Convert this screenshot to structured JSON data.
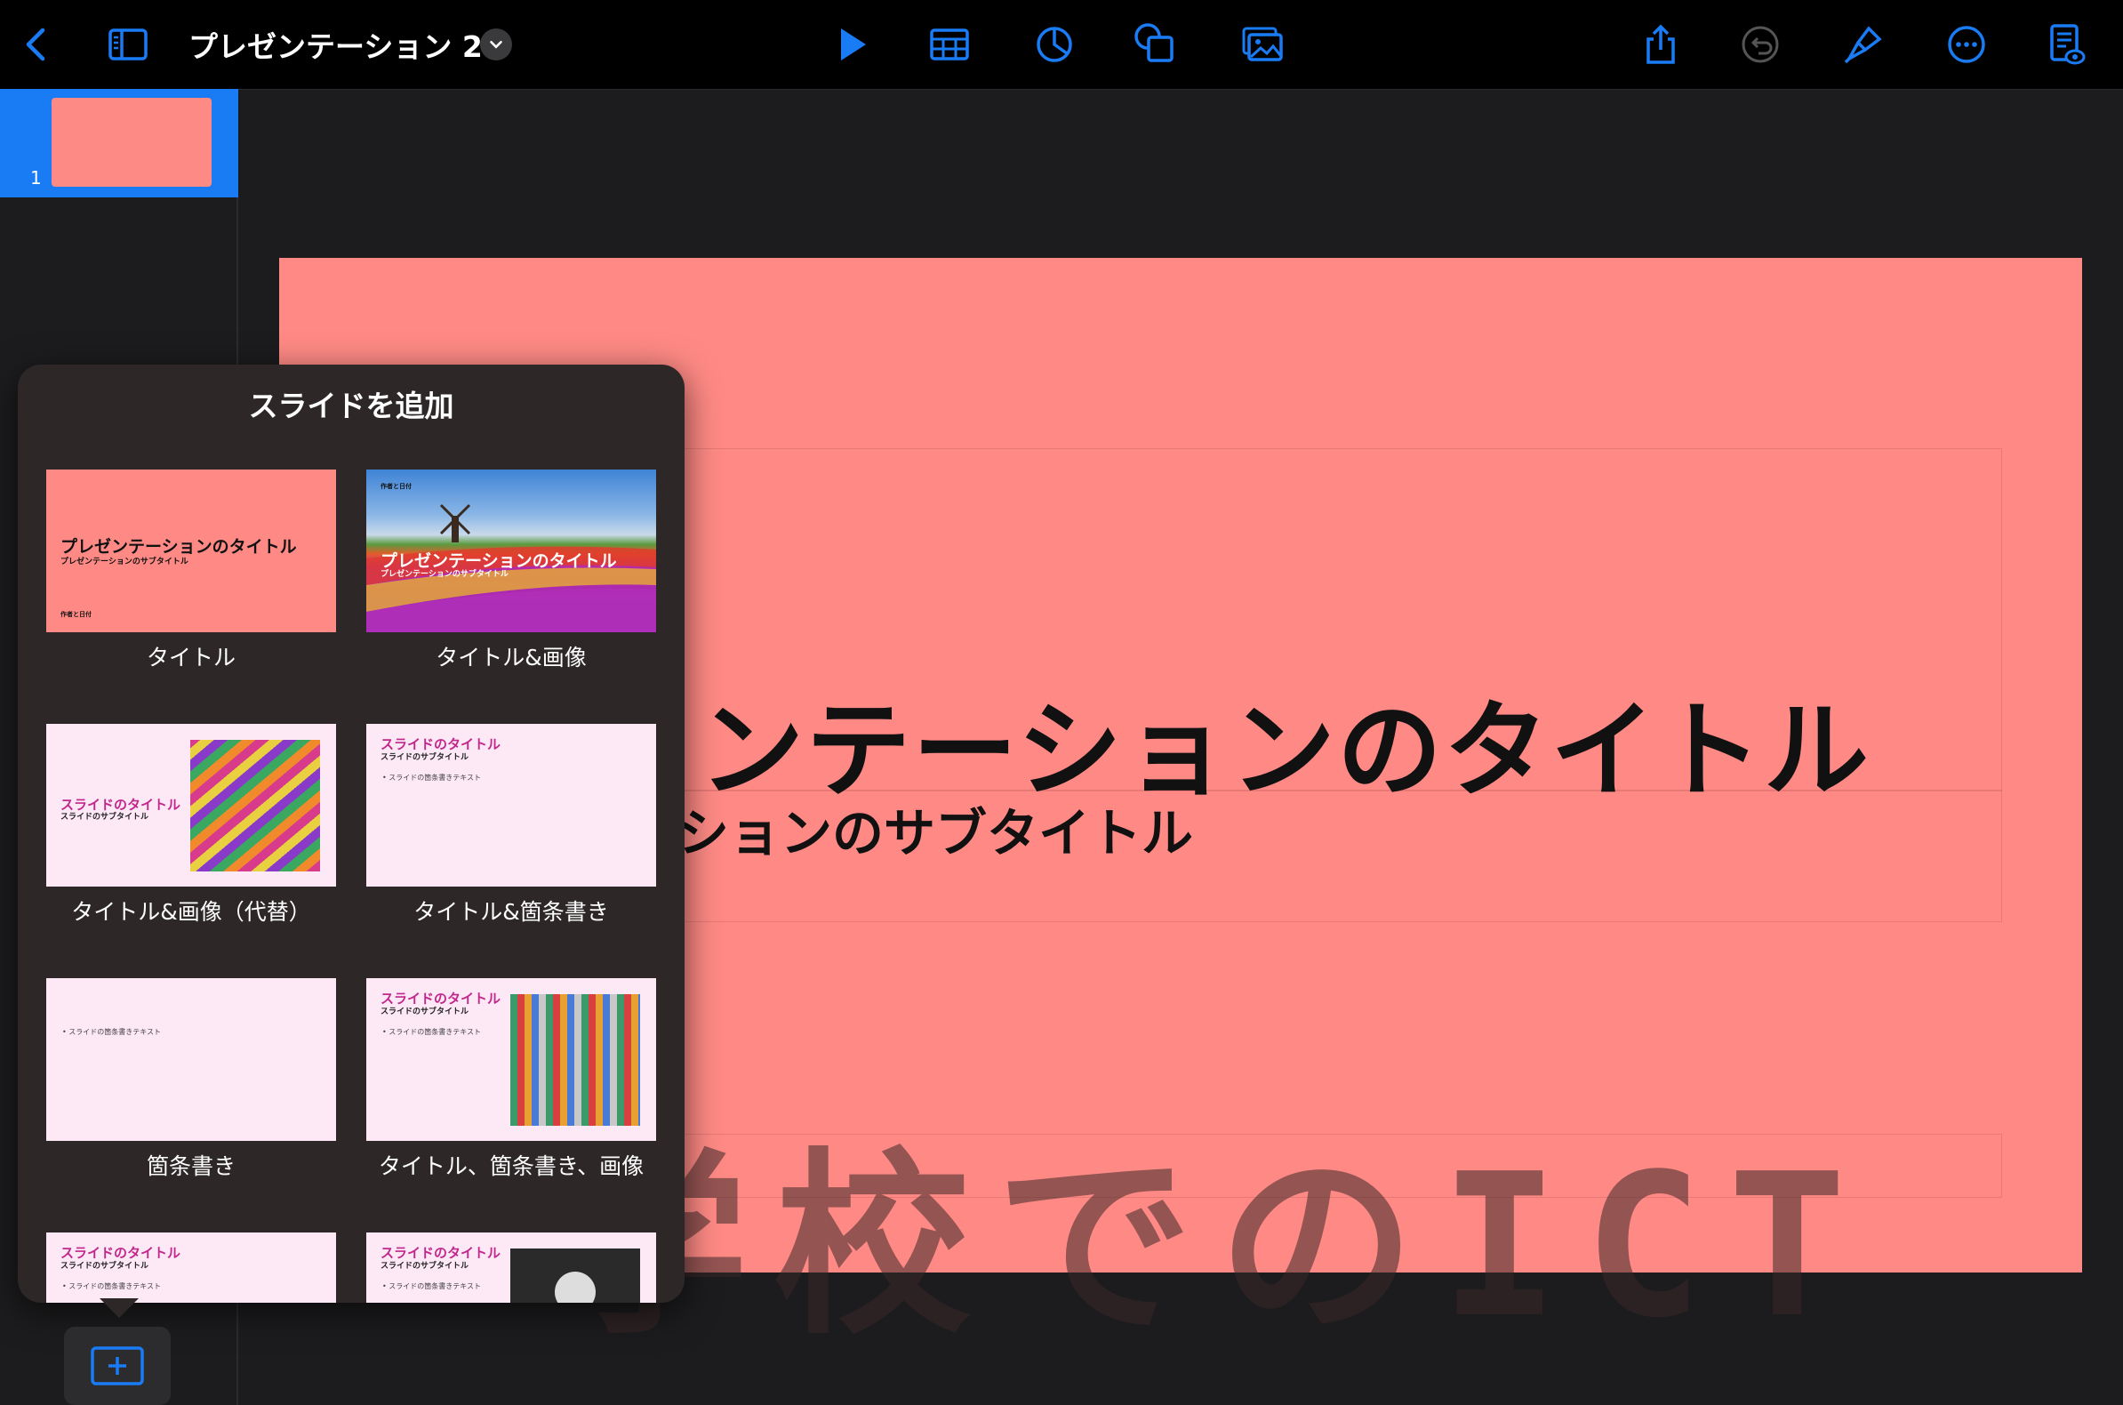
{
  "toolbar": {
    "doc_title": "プレゼンテーション 2",
    "icons": [
      "back-chevron-icon",
      "sidebar-icon",
      "title-chevron-icon",
      "play-icon",
      "table-icon",
      "chart-icon",
      "shape-icon",
      "media-icon",
      "share-icon",
      "undo-icon",
      "format-brush-icon",
      "more-icon",
      "document-setup-icon"
    ],
    "accent_color": "#1a7cf5"
  },
  "navigator": {
    "slides": [
      {
        "number": "1",
        "color": "#fe8a85"
      }
    ]
  },
  "slide": {
    "background": "#ff8a85",
    "title_visible": "ンテーションのタイトル",
    "subtitle_visible": "ションのサブタイトル"
  },
  "watermark": {
    "text": "学校でのICT"
  },
  "add_slide_popover": {
    "title": "スライドを追加",
    "layouts": [
      {
        "label": "タイトル",
        "thumb_title": "プレゼンテーションのタイトル",
        "thumb_subtitle": "プレゼンテーションのサブタイトル",
        "thumb_footer": "作者と日付"
      },
      {
        "label": "タイトル&画像",
        "thumb_title": "プレゼンテーションのタイトル",
        "thumb_subtitle": "プレゼンテーションのサブタイトル",
        "thumb_footer": "作者と日付"
      },
      {
        "label": "タイトル&画像（代替）",
        "thumb_title": "スライドのタイトル",
        "thumb_subtitle": "スライドのサブタイトル"
      },
      {
        "label": "タイトル&箇条書き",
        "thumb_title": "スライドのタイトル",
        "thumb_subtitle": "スライドのサブタイトル",
        "thumb_bullet": "スライドの箇条書きテキスト"
      },
      {
        "label": "箇条書き",
        "thumb_bullet": "スライドの箇条書きテキスト"
      },
      {
        "label": "タイトル、箇条書き、画像",
        "thumb_title": "スライドのタイトル",
        "thumb_subtitle": "スライドのサブタイトル",
        "thumb_bullet": "スライドの箇条書きテキスト"
      },
      {
        "thumb_title": "スライドのタイトル",
        "thumb_subtitle": "スライドのサブタイトル",
        "thumb_bullet": "スライドの箇条書きテキスト"
      },
      {
        "thumb_title": "スライドのタイトル",
        "thumb_subtitle": "スライドのサブタイトル",
        "thumb_bullet": "スライドの箇条書きテキスト"
      }
    ]
  },
  "add_slide_button": {
    "icon": "plus-in-box-icon"
  }
}
